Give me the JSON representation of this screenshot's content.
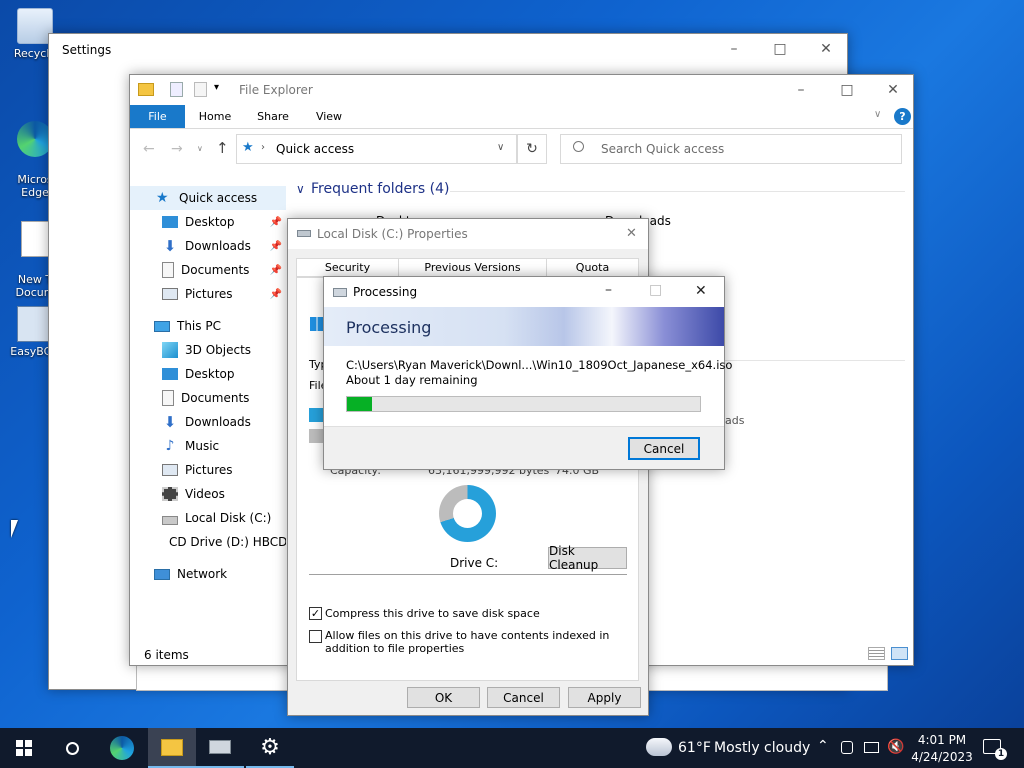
{
  "desktop": {
    "icons": [
      {
        "label": "Recycle"
      },
      {
        "label": "Micros\nEdge"
      },
      {
        "label": "New T\nDocum"
      },
      {
        "label": "EasyBCD"
      }
    ]
  },
  "settings_window": {
    "title": "Settings"
  },
  "explorer": {
    "title": "File Explorer",
    "ribbon_tabs": [
      "File",
      "Home",
      "Share",
      "View"
    ],
    "address": "Quick access",
    "search_placeholder": "Search Quick access",
    "section_header": "Frequent folders (4)",
    "partial_items": [
      "Deskt",
      "Downloads"
    ],
    "partial_side_text": "ads",
    "nav": {
      "quick_access": "Quick access",
      "quick_items": [
        "Desktop",
        "Downloads",
        "Documents",
        "Pictures"
      ],
      "this_pc": "This PC",
      "pc_items": [
        "3D Objects",
        "Desktop",
        "Documents",
        "Downloads",
        "Music",
        "Pictures",
        "Videos",
        "Local Disk (C:)",
        "CD Drive (D:) HBCD"
      ],
      "network": "Network"
    },
    "status": "6 items"
  },
  "properties": {
    "title": "Local Disk (C:) Properties",
    "tabs": [
      "Security",
      "Previous Versions",
      "Quota"
    ],
    "partial_labels": [
      "Typ",
      "File"
    ],
    "capacity_label": "Capacity:",
    "capacity_bytes": "63,161,999,992 bytes",
    "capacity_gb": "74.0 GB",
    "drive_label": "Drive C:",
    "disk_cleanup": "Disk Cleanup",
    "compress_label": "Compress this drive to save disk space",
    "index_label": "Allow files on this drive to have contents indexed in addition to file properties",
    "ok": "OK",
    "cancel": "Cancel",
    "apply": "Apply"
  },
  "processing": {
    "title": "Processing",
    "header": "Processing",
    "path": "C:\\Users\\Ryan Maverick\\Downl...\\Win10_1809Oct_Japanese_x64.iso",
    "remaining": "About 1 day remaining",
    "progress": 0.07,
    "cancel": "Cancel"
  },
  "taskbar": {
    "weather_temp": "61°F",
    "weather_desc": "Mostly cloudy",
    "time": "4:01 PM",
    "date": "4/24/2023",
    "notif_count": "1"
  },
  "colors": {
    "accent": "#0078d7",
    "progress": "#06b025",
    "taskbar": "#101a2c"
  }
}
